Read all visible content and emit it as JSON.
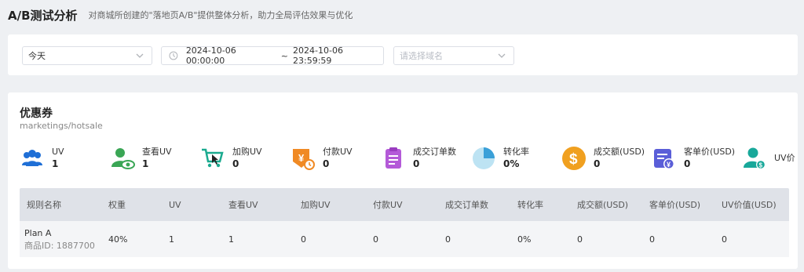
{
  "header": {
    "title": "A/B测试分析",
    "description": "对商城所创建的\"落地页A/B\"提供整体分析，助力全局评估效果与优化"
  },
  "filters": {
    "period": "今天",
    "date_start": "2024-10-06 00:00:00",
    "date_separator": "~",
    "date_end": "2024-10-06 23:59:59",
    "domain_placeholder": "请选择域名"
  },
  "section": {
    "title": "优惠券",
    "subtitle": "marketings/hotsale"
  },
  "metrics": [
    {
      "label": "UV",
      "value": "1",
      "icon": "users-icon",
      "color": "#1f6fd6"
    },
    {
      "label": "查看UV",
      "value": "1",
      "icon": "user-view-icon",
      "color": "#3aa655"
    },
    {
      "label": "加购UV",
      "value": "0",
      "icon": "cart-icon",
      "color": "#1aaa8f"
    },
    {
      "label": "付款UV",
      "value": "0",
      "icon": "payment-icon",
      "color": "#f08a24"
    },
    {
      "label": "成交订单数",
      "value": "0",
      "icon": "order-icon",
      "color": "#b45ad8"
    },
    {
      "label": "转化率",
      "value": "0%",
      "icon": "pie-icon",
      "color": "#3aa0d8"
    },
    {
      "label": "成交额(USD)",
      "value": "0",
      "icon": "dollar-icon",
      "color": "#f0a020"
    },
    {
      "label": "客单价(USD)",
      "value": "0",
      "icon": "receipt-icon",
      "color": "#5a5ed8"
    },
    {
      "label": "UV价",
      "value": "",
      "icon": "user-value-icon",
      "color": "#18a89a"
    }
  ],
  "table": {
    "headers": [
      "规则名称",
      "权重",
      "UV",
      "查看UV",
      "加购UV",
      "付款UV",
      "成交订单数",
      "转化率",
      "成交额(USD)",
      "客单价(USD)",
      "UV价值(USD)"
    ],
    "rows": [
      {
        "name": "Plan A",
        "product_id": "商品ID: 1887700",
        "weight": "40%",
        "uv": "1",
        "view_uv": "1",
        "cart_uv": "0",
        "pay_uv": "0",
        "orders": "0",
        "conversion": "0%",
        "revenue": "0",
        "aov": "0",
        "uv_value": "0"
      }
    ]
  }
}
